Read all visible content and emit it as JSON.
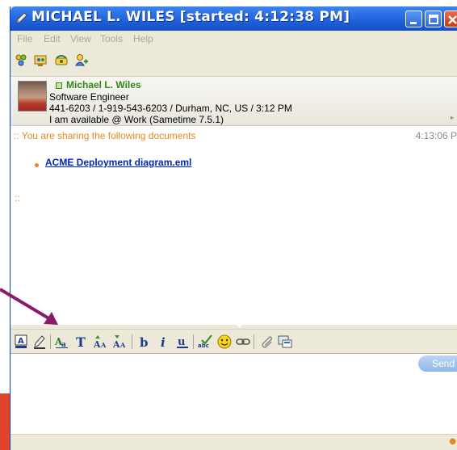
{
  "window": {
    "title": "MICHAEL L. WILES [started: 4:12:38 PM]",
    "title_icon": "pencil-icon",
    "controls": [
      "minimize-icon",
      "maximize-icon",
      "close-icon"
    ]
  },
  "menu": {
    "items": [
      "File",
      "Edit",
      "View",
      "Tools",
      "Help"
    ]
  },
  "toolbar": {
    "icons": [
      "invite-people-icon",
      "conference-icon",
      "phone-icon",
      "add-contact-icon"
    ]
  },
  "contact": {
    "name": "Michael L. Wiles",
    "title": "Software Engineer",
    "details": "441-6203 / 1-919-543-6203 / Durham, NC, US / 3:12 PM",
    "status": "I am available @ Work (Sametime 7.5.1)",
    "status_color": "#2f8a18"
  },
  "chat": {
    "system_message": ":: You are sharing the following documents",
    "timestamp": "4:13:06 P",
    "document_link": "ACME Deployment diagram.eml",
    "separator": "::"
  },
  "format_toolbar": {
    "tools": [
      "text-color-icon",
      "highlight-icon",
      "font-icon",
      "text-size-icon",
      "grow-font-icon",
      "shrink-font-icon",
      "bold-icon",
      "italic-icon",
      "underline-icon",
      "spell-check-icon",
      "emoticon-icon",
      "link-icon",
      "attach-icon",
      "screen-capture-icon"
    ]
  },
  "input": {
    "send_label": "Send"
  },
  "colors": {
    "titlebar": "#1c5bd6",
    "accent": "#e28a1e",
    "link": "#0026c4",
    "annotation_arrow": "#8b1a6b"
  }
}
